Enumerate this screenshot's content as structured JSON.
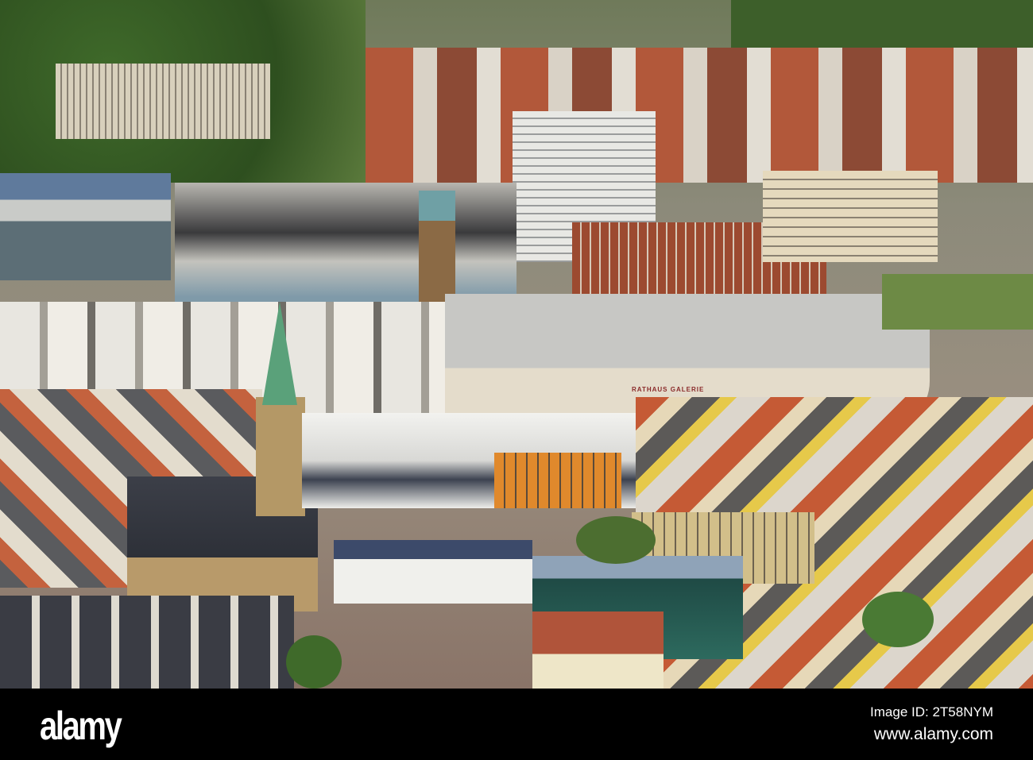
{
  "photo": {
    "subject": "Aerial view of city centre",
    "building_sign": "RATHAUS GALERIE"
  },
  "footer": {
    "logo": "alamy",
    "image_id": "Image ID: 2T58NYM",
    "website": "www.alamy.com"
  },
  "colors": {
    "footer_bg": "#000000",
    "footer_text": "#ffffff"
  }
}
